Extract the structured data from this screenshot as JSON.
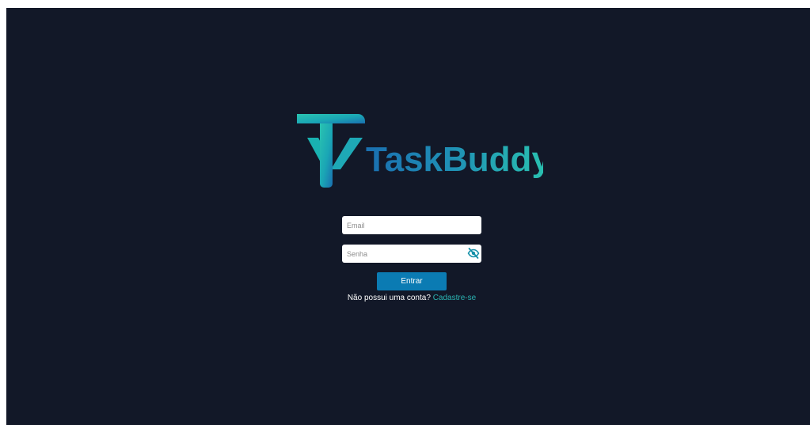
{
  "brand": {
    "name_part1": "Task",
    "name_part2": "Buddy",
    "colors": {
      "gradient_start": "#1a6fb0",
      "gradient_end": "#2ac3b0"
    }
  },
  "form": {
    "email_placeholder": "Email",
    "password_placeholder": "Senha",
    "password_toggle_icon": "eye-slash-icon",
    "submit_label": "Entrar",
    "signup_prompt": "Não possui uma conta?",
    "signup_link": "Cadastre-se"
  },
  "colors": {
    "background": "#121828",
    "button": "#0b7bb3",
    "link": "#2bb5b3",
    "icon": "#1490a8"
  }
}
